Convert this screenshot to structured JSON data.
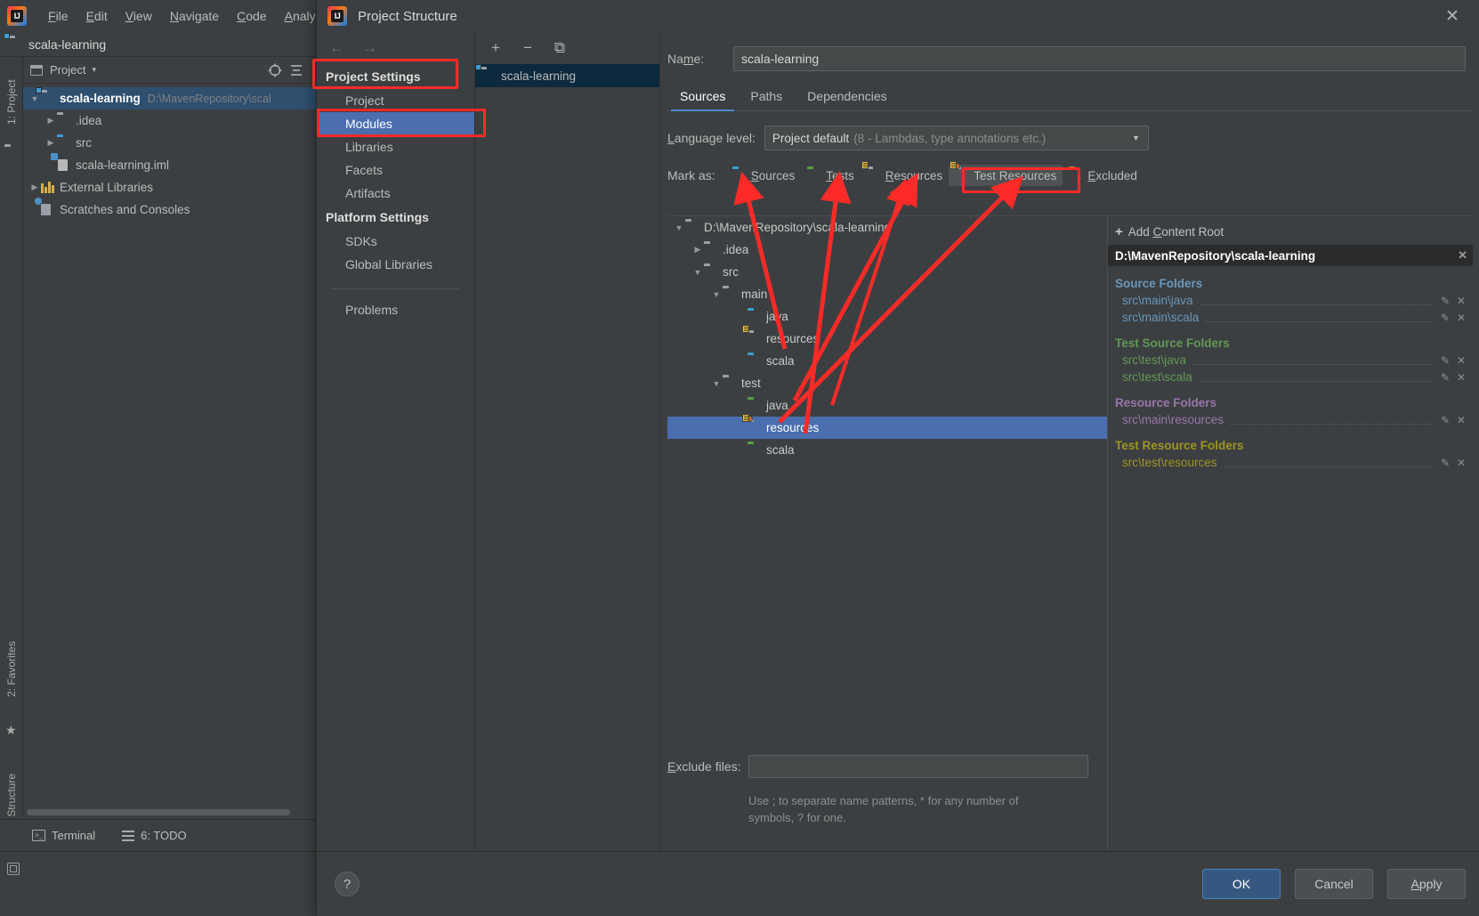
{
  "ide": {
    "menu": [
      {
        "label": "File",
        "mnemonic": "F"
      },
      {
        "label": "Edit",
        "mnemonic": "E"
      },
      {
        "label": "View",
        "mnemonic": "V"
      },
      {
        "label": "Navigate",
        "mnemonic": "N"
      },
      {
        "label": "Code",
        "mnemonic": "C"
      },
      {
        "label": "Analyze",
        "mnemonic": "A"
      }
    ],
    "project_header": "scala-learning",
    "tool_window": {
      "title": "Project",
      "chevron": "▾",
      "tree": [
        {
          "label": "scala-learning",
          "path": "D:\\MavenRepository\\scal",
          "icon": "folder-module",
          "depth": 0,
          "expanded": true,
          "bold": true,
          "selected": true
        },
        {
          "label": ".idea",
          "path": "",
          "icon": "folder-grey",
          "depth": 1,
          "expanded": false,
          "bold": false,
          "selected": false
        },
        {
          "label": "src",
          "path": "",
          "icon": "folder-blue",
          "depth": 1,
          "expanded": false,
          "bold": false,
          "selected": false
        },
        {
          "label": "scala-learning.iml",
          "path": "",
          "icon": "iml-file",
          "depth": 1,
          "expanded": null,
          "bold": false,
          "selected": false
        },
        {
          "label": "External Libraries",
          "path": "",
          "icon": "libraries",
          "depth": 0,
          "expanded": false,
          "bold": false,
          "selected": false
        },
        {
          "label": "Scratches and Consoles",
          "path": "",
          "icon": "scratches",
          "depth": 0,
          "expanded": null,
          "bold": false,
          "selected": false
        }
      ]
    },
    "side_tabs_left": [
      "1: Project"
    ],
    "side_tabs_bottom": [
      "2: Favorites",
      "7: Structure"
    ],
    "bottom_bar": [
      {
        "label": "Terminal",
        "icon": "terminal-icon"
      },
      {
        "label": "6: TODO",
        "icon": "todo-icon",
        "mnemonic": "6"
      }
    ]
  },
  "dialog": {
    "title": "Project Structure",
    "close_label": "✕",
    "nav": {
      "back": "←",
      "forward": "→",
      "groups": [
        {
          "title": "Project Settings",
          "items": [
            {
              "label": "Project",
              "selected": false
            },
            {
              "label": "Modules",
              "selected": true
            },
            {
              "label": "Libraries",
              "selected": false
            },
            {
              "label": "Facets",
              "selected": false
            },
            {
              "label": "Artifacts",
              "selected": false
            }
          ]
        },
        {
          "title": "Platform Settings",
          "items": [
            {
              "label": "SDKs",
              "selected": false
            },
            {
              "label": "Global Libraries",
              "selected": false
            }
          ]
        }
      ],
      "extra": [
        {
          "label": "Problems",
          "selected": false
        }
      ]
    },
    "modules": {
      "toolbar": [
        {
          "name": "add-module-button",
          "glyph": "+"
        },
        {
          "name": "remove-module-button",
          "glyph": "−"
        },
        {
          "name": "copy-module-button",
          "glyph": "⧉"
        }
      ],
      "items": [
        {
          "label": "scala-learning",
          "selected": true
        }
      ]
    },
    "detail": {
      "name_label": "Name:",
      "name_mnemonic": "m",
      "name_value": "scala-learning",
      "tabs": [
        {
          "label": "Sources",
          "active": true
        },
        {
          "label": "Paths",
          "active": false
        },
        {
          "label": "Dependencies",
          "active": false
        }
      ],
      "language_level": {
        "label": "Language level:",
        "mnemonic": "L",
        "value": "Project default",
        "value_detail": "(8 - Lambdas, type annotations etc.)",
        "chevron": "▼"
      },
      "mark_as": {
        "label": "Mark as:",
        "buttons": [
          {
            "label": "Sources",
            "mnemonic": "S",
            "icon": "folder-sources",
            "active": false
          },
          {
            "label": "Tests",
            "mnemonic": "T",
            "icon": "folder-tests",
            "active": false
          },
          {
            "label": "Resources",
            "mnemonic": "R",
            "icon": "folder-resources",
            "active": false
          },
          {
            "label": "Test Resources",
            "mnemonic": "",
            "icon": "folder-test-resources",
            "active": true
          },
          {
            "label": "Excluded",
            "mnemonic": "E",
            "icon": "folder-excluded",
            "active": false
          }
        ]
      },
      "source_tree": [
        {
          "label": "D:\\MavenRepository\\scala-learning",
          "depth": 0,
          "expanded": true,
          "icon": "folder-grey",
          "selected": false
        },
        {
          "label": ".idea",
          "depth": 1,
          "expanded": false,
          "icon": "folder-grey",
          "selected": false
        },
        {
          "label": "src",
          "depth": 1,
          "expanded": true,
          "icon": "folder-grey",
          "selected": false
        },
        {
          "label": "main",
          "depth": 2,
          "expanded": true,
          "icon": "folder-grey",
          "selected": false
        },
        {
          "label": "java",
          "depth": 3,
          "expanded": null,
          "icon": "folder-blue",
          "selected": false
        },
        {
          "label": "resources",
          "depth": 3,
          "expanded": null,
          "icon": "folder-resources",
          "selected": false
        },
        {
          "label": "scala",
          "depth": 3,
          "expanded": null,
          "icon": "folder-blue",
          "selected": false
        },
        {
          "label": "test",
          "depth": 2,
          "expanded": true,
          "icon": "folder-grey",
          "selected": false
        },
        {
          "label": "java",
          "depth": 3,
          "expanded": null,
          "icon": "folder-green",
          "selected": false
        },
        {
          "label": "resources",
          "depth": 3,
          "expanded": null,
          "icon": "folder-test-resources",
          "selected": true
        },
        {
          "label": "scala",
          "depth": 3,
          "expanded": null,
          "icon": "folder-green",
          "selected": false
        }
      ],
      "content_roots": {
        "add_label": "Add Content Root",
        "add_mnemonic": "C",
        "add_glyph": "+",
        "root_path": "D:\\MavenRepository\\scala-learning",
        "root_remove": "✕",
        "groups": [
          {
            "title": "Source Folders",
            "kind": "src",
            "paths": [
              "src\\main\\java",
              "src\\main\\scala"
            ]
          },
          {
            "title": "Test Source Folders",
            "kind": "tst",
            "paths": [
              "src\\test\\java",
              "src\\test\\scala"
            ]
          },
          {
            "title": "Resource Folders",
            "kind": "res",
            "paths": [
              "src\\main\\resources"
            ]
          },
          {
            "title": "Test Resource Folders",
            "kind": "tres",
            "paths": [
              "src\\test\\resources"
            ]
          }
        ],
        "edit_glyph": "✎",
        "remove_glyph": "✕"
      },
      "exclude": {
        "label": "Exclude files:",
        "mnemonic": "E",
        "value": "",
        "hint_line1": "Use ; to separate name patterns, * for any number of",
        "hint_line2": "symbols, ? for one."
      }
    },
    "footer": {
      "help_glyph": "?",
      "buttons": [
        {
          "label": "OK",
          "primary": true
        },
        {
          "label": "Cancel",
          "primary": false
        },
        {
          "label": "Apply",
          "primary": false,
          "mnemonic": "A"
        }
      ]
    }
  },
  "annotations": {
    "accent_color": "#fc2b28",
    "highlight_boxes": [
      "project-settings-title",
      "modules-nav-item",
      "test-resources-button"
    ],
    "arrow_count": 5
  }
}
